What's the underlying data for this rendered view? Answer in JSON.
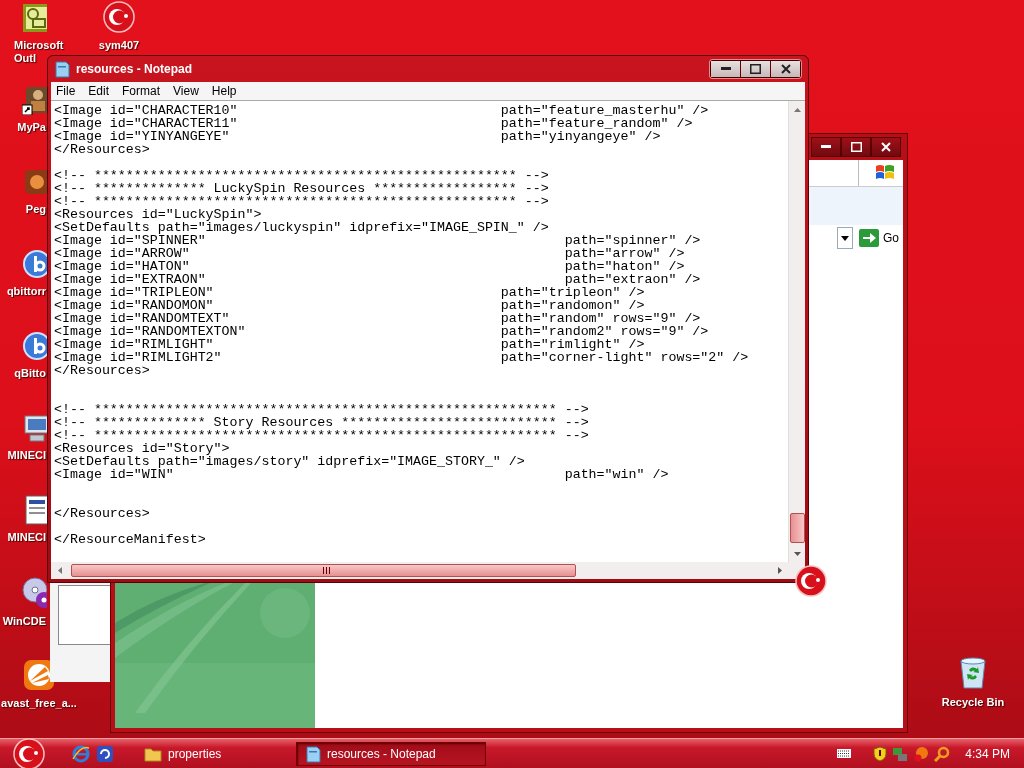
{
  "desktop_icons": [
    {
      "label": "Microsoft Outl",
      "kind": "mail",
      "clipped": true
    },
    {
      "label": "MyPa",
      "kind": "figure",
      "clipped": true
    },
    {
      "label": "Peg",
      "kind": "app",
      "clipped": true
    },
    {
      "label": "qbittorr",
      "kind": "torrent",
      "clipped": true
    },
    {
      "label": "qBitto",
      "kind": "torrent",
      "clipped": true
    },
    {
      "label": "MINECI",
      "kind": "computer",
      "clipped": true
    },
    {
      "label": "MINECI",
      "kind": "document",
      "clipped": true
    },
    {
      "label": "WinCDE",
      "kind": "disc",
      "clipped": true
    },
    {
      "label": "avast_free_a...",
      "kind": "avast",
      "clipped": false
    }
  ],
  "desktop_extra": [
    {
      "label": "sym407",
      "kind": "crescent",
      "clipped": false
    },
    {
      "label": "Recycle Bin",
      "kind": "bin",
      "clipped": false
    }
  ],
  "background_window": {
    "go_button": "Go"
  },
  "notepad": {
    "title": "resources - Notepad",
    "menu": [
      "File",
      "Edit",
      "Format",
      "View",
      "Help"
    ],
    "lines": [
      {
        "kind": "text",
        "text": "<Image id=\"CHARACTER10\"                                 path=\"feature_masterhu\" />"
      },
      {
        "kind": "text",
        "text": "<Image id=\"CHARACTER11\"                                 path=\"feature_random\" />"
      },
      {
        "kind": "text",
        "text": "<Image id=\"YINYANGEYE\"                                  path=\"yinyangeye\" />"
      },
      {
        "kind": "text",
        "text": "</Resources>"
      },
      {
        "kind": "blank"
      },
      {
        "kind": "text",
        "text": "<!-- ***************************************************** -->"
      },
      {
        "kind": "text",
        "text": "<!-- ************** LuckySpin Resources ****************** -->"
      },
      {
        "kind": "text",
        "text": "<!-- ***************************************************** -->"
      },
      {
        "kind": "text",
        "text": "<Resources id=\"LuckySpin\">"
      },
      {
        "kind": "text",
        "text": "<SetDefaults path=\"images/luckyspin\" idprefix=\"IMAGE_SPIN_\" />"
      },
      {
        "kind": "text",
        "text": "<Image id=\"SPINNER\"                                             path=\"spinner\" />"
      },
      {
        "kind": "text",
        "text": "<Image id=\"ARROW\"                                               path=\"arrow\" />"
      },
      {
        "kind": "text",
        "text": "<Image id=\"HATON\"                                               path=\"haton\" />"
      },
      {
        "kind": "text",
        "text": "<Image id=\"EXTRAON\"                                             path=\"extraon\" />"
      },
      {
        "kind": "text",
        "text": "<Image id=\"TRIPLEON\"                                    path=\"tripleon\" />"
      },
      {
        "kind": "text",
        "text": "<Image id=\"RANDOMON\"                                    path=\"randomon\" />"
      },
      {
        "kind": "text",
        "text": "<Image id=\"RANDOMTEXT\"                                  path=\"random\" rows=\"9\" />"
      },
      {
        "kind": "text",
        "text": "<Image id=\"RANDOMTEXTON\"                                path=\"random2\" rows=\"9\" />"
      },
      {
        "kind": "text",
        "text": "<Image id=\"RIMLIGHT\"                                    path=\"rimlight\" />"
      },
      {
        "kind": "text",
        "text": "<Image id=\"RIMLIGHT2\"                                   path=\"corner-light\" rows=\"2\" />"
      },
      {
        "kind": "text",
        "text": "</Resources>"
      },
      {
        "kind": "blank"
      },
      {
        "kind": "blank"
      },
      {
        "kind": "text",
        "text": "<!-- ********************************************************** -->"
      },
      {
        "kind": "text",
        "text": "<!-- ************** Story Resources *************************** -->"
      },
      {
        "kind": "text",
        "text": "<!-- ********************************************************** -->"
      },
      {
        "kind": "text",
        "text": "<Resources id=\"Story\">"
      },
      {
        "kind": "text",
        "text": "<SetDefaults path=\"images/story\" idprefix=\"IMAGE_STORY_\" />"
      },
      {
        "kind": "text",
        "text": "<Image id=\"WIN\"                                                 path=\"win\" />"
      },
      {
        "kind": "blank"
      },
      {
        "kind": "blank"
      },
      {
        "kind": "text",
        "text": "</Resources>"
      },
      {
        "kind": "blank"
      },
      {
        "kind": "text",
        "text": "</ResourceManifest>"
      }
    ]
  },
  "taskbar": {
    "tasks": [
      {
        "label": "properties",
        "kind": "folder",
        "selected": false
      },
      {
        "label": "resources - Notepad",
        "kind": "notepad",
        "selected": true
      }
    ],
    "clock": "4:34 PM"
  }
}
